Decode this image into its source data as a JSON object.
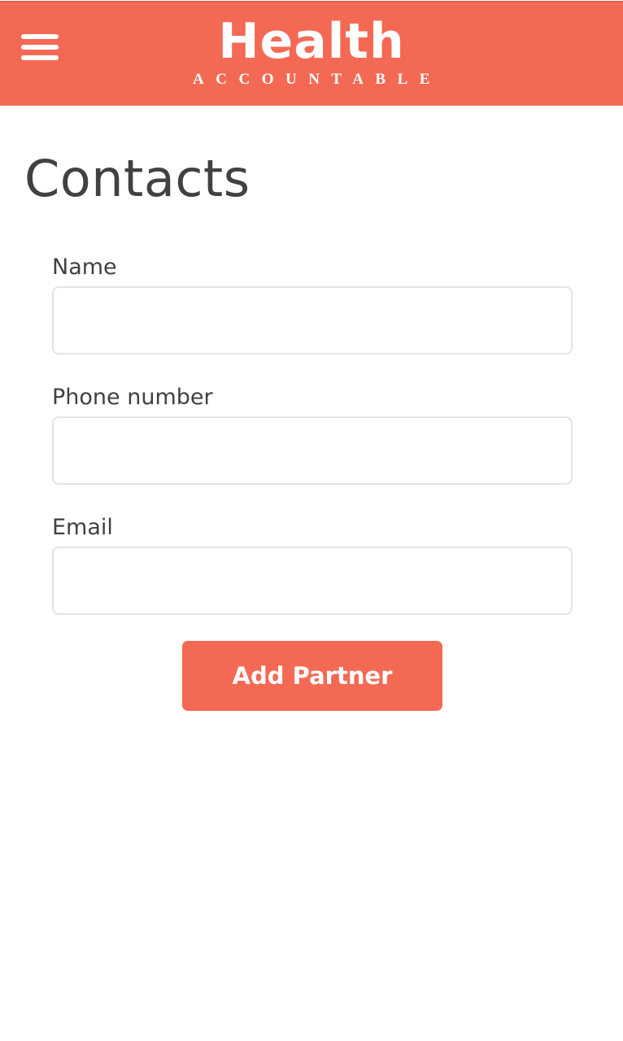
{
  "header": {
    "brand_title": "Health",
    "brand_subtitle": "ACCOUNTABLE",
    "menu_icon": "hamburger-menu-icon",
    "accent_color": "#f46954"
  },
  "page": {
    "title": "Contacts"
  },
  "form": {
    "fields": [
      {
        "label": "Name",
        "value": "",
        "placeholder": ""
      },
      {
        "label": "Phone number",
        "value": "",
        "placeholder": ""
      },
      {
        "label": "Email",
        "value": "",
        "placeholder": ""
      }
    ],
    "submit_label": "Add Partner"
  }
}
